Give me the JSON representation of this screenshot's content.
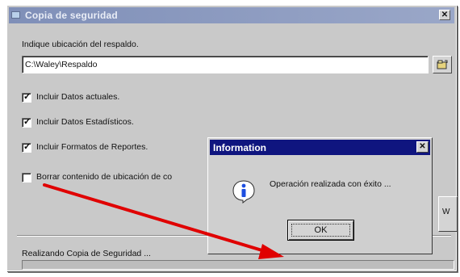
{
  "window": {
    "title": "Copia de seguridad",
    "path_label": "Indique ubicación del respaldo.",
    "path_value": "C:\\Waley\\Respaldo",
    "options": [
      {
        "label": "Incluir Datos actuales.",
        "checked": true
      },
      {
        "label": "Incluir Datos Estadísticos.",
        "checked": true
      },
      {
        "label": "Incluir Formatos de Reportes.",
        "checked": true
      },
      {
        "label": "Borrar contenido de ubicación de co",
        "checked": false
      }
    ],
    "hidden_button_label": "W",
    "status_text": "Realizando Copia de Seguridad ..."
  },
  "dialog": {
    "title": "Information",
    "message": "Operación realizada con éxito ...",
    "ok_label": "OK"
  },
  "icons": {
    "window": "window-icon",
    "browse": "folder-browse-icon",
    "dialog": "info-icon"
  },
  "colors": {
    "window_background": "#c9c9c9",
    "dialog_title": "#0f157f",
    "arrow": "#e00000"
  }
}
